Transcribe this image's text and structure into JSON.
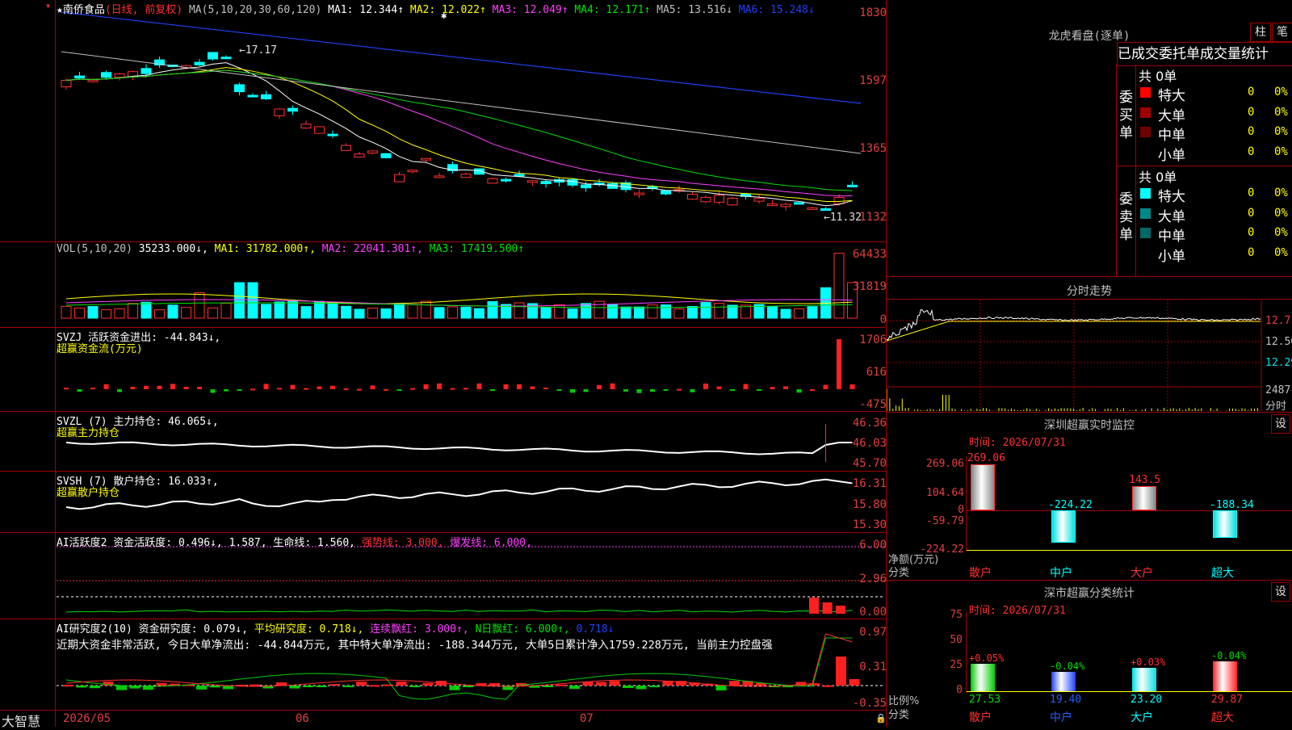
{
  "stock": {
    "name": "★南侨食品",
    "period": "(日线, 前复权)",
    "ma_line": [
      {
        "t": "MA(5,10,20,30,60,120)",
        "c": "#c0c0c0"
      },
      {
        "t": "MA1: 12.344↑",
        "c": "#ffffff"
      },
      {
        "t": "MA2: 12.022↑",
        "c": "#ffff00"
      },
      {
        "t": "MA3: 12.049↑",
        "c": "#ff40ff"
      },
      {
        "t": "MA4: 12.171↑",
        "c": "#00e000"
      },
      {
        "t": "MA5: 13.516↓",
        "c": "#c0c0c0"
      },
      {
        "t": "MA6: 15.248↓",
        "c": "#2040ff"
      }
    ],
    "price_axis": [
      "1830",
      "1597",
      "1365",
      "1132"
    ],
    "high_label": "17.17",
    "low_label": "11.32"
  },
  "volume": {
    "header": [
      {
        "t": "VOL(5,10,20)",
        "c": "#c0c0c0"
      },
      {
        "t": "35233.000↓,",
        "c": "#ffffff"
      },
      {
        "t": "MA1: 31782.000↑,",
        "c": "#ffff00"
      },
      {
        "t": "MA2: 22041.301↑,",
        "c": "#ff40ff"
      },
      {
        "t": "MA3: 17419.500↑",
        "c": "#00e000"
      }
    ],
    "axis": [
      "64433",
      "31819",
      "0"
    ]
  },
  "svzj": {
    "line1": "SVZJ  活跃资金进出: -44.843↓,",
    "line2": "超赢资金流(万元)",
    "axis": [
      "1706",
      "616",
      "-475"
    ]
  },
  "svzl": {
    "line1": "SVZL (7) 主力持仓: 46.065↓,",
    "line2": "超赢主力持仓",
    "axis": [
      "46.36",
      "46.03",
      "45.70"
    ]
  },
  "svsh": {
    "line1": "SVSH (7) 散户持仓: 16.033↑,",
    "line2": "超赢散户持仓",
    "axis": [
      "16.31",
      "15.80",
      "15.30"
    ]
  },
  "ai_active": {
    "header": [
      {
        "t": "AI活跃度2 资金活跃度: 0.496↓,",
        "c": "#ffffff"
      },
      {
        "t": "1.587,",
        "c": "#ffffff"
      },
      {
        "t": "生命线: 1.560,",
        "c": "#ffffff"
      },
      {
        "t": "强势线: 3.000,",
        "c": "#ff3030"
      },
      {
        "t": "爆发线: 6.000,",
        "c": "#ff40ff"
      }
    ],
    "axis": [
      "6.00",
      "2.96",
      "0.00"
    ]
  },
  "ai_research": {
    "header": [
      {
        "t": "AI研究度2(10) 资金研究度: 0.079↓,",
        "c": "#ffffff"
      },
      {
        "t": "平均研究度: 0.718↓,",
        "c": "#ffff00"
      },
      {
        "t": "连续飘红: 3.000↑,",
        "c": "#ff40ff"
      },
      {
        "t": "N日飘红: 6.000↑,",
        "c": "#00e000"
      },
      {
        "t": "0.718↓",
        "c": "#2040ff"
      }
    ],
    "comment": "近期大资金非常活跃, 今日大单净流出: -44.844万元, 其中特大单净流出: -188.344万元, 大单5日累计净入1759.228万元, 当前主力控盘强",
    "axis": [
      "0.97",
      "0.31",
      "-0.35"
    ]
  },
  "date_axis": {
    "brand": "大智慧",
    "labels": [
      "2026/05",
      "06",
      "07"
    ]
  },
  "dragon_tiger": {
    "title": "龙虎看盘(逐单)",
    "btn_bar": "柱",
    "btn_pen": "笔",
    "tabs": [
      "已成交",
      "委托单",
      "成交量统计"
    ],
    "buy_side_label": "委买单",
    "sell_side_label": "委卖单",
    "buy_total": "共 0单",
    "sell_total": "共 0单",
    "buy_rows": [
      {
        "label": "特大",
        "count": "0",
        "pct": "0%",
        "color": "#ff0000"
      },
      {
        "label": "大单",
        "count": "0",
        "pct": "0%",
        "color": "#a00000"
      },
      {
        "label": "中单",
        "count": "0",
        "pct": "0%",
        "color": "#700000"
      },
      {
        "label": "小单",
        "count": "0",
        "pct": "0%",
        "color": "#000000"
      }
    ],
    "sell_rows": [
      {
        "label": "特大",
        "count": "0",
        "pct": "0%",
        "color": "#00ffff"
      },
      {
        "label": "大单",
        "count": "0",
        "pct": "0%",
        "color": "#008888"
      },
      {
        "label": "中单",
        "count": "0",
        "pct": "0%",
        "color": "#006868"
      },
      {
        "label": "小单",
        "count": "0",
        "pct": "0%",
        "color": "#000000"
      }
    ]
  },
  "intraday": {
    "title": "分时走势",
    "axis": [
      "12.71",
      "12.50",
      "12.29"
    ],
    "vol_label": "2487",
    "unit": "分时"
  },
  "sz_monitor": {
    "title": "深圳超赢实时监控",
    "btn": "设",
    "time": "时间: 2026/07/31",
    "axis": [
      "269.06",
      "104.64",
      "0",
      "-59.79",
      "-224.22"
    ],
    "side_label_1": "净额(万元)",
    "side_label_2": "分类",
    "bars": [
      {
        "cat": "散户",
        "value": "269.06",
        "v": 269.06,
        "cat_color": "#ff3030",
        "val_color": "#ff3030"
      },
      {
        "cat": "中户",
        "value": "-224.22",
        "v": -224.22,
        "cat_color": "#00ffff",
        "val_color": "#00ffff"
      },
      {
        "cat": "大户",
        "value": "143.5",
        "v": 143.5,
        "cat_color": "#ff3030",
        "val_color": "#ff3030"
      },
      {
        "cat": "超大",
        "value": "-188.34",
        "v": -188.34,
        "cat_color": "#00ffff",
        "val_color": "#00ffff"
      }
    ]
  },
  "sz_class": {
    "title": "深市超赢分类统计",
    "btn": "设",
    "time": "时间: 2026/07/31",
    "axis": [
      "75",
      "50",
      "25",
      "0"
    ],
    "side_label_1": "比例%",
    "side_label_2": "分类",
    "bars": [
      {
        "cat": "散户",
        "pct_text": "27.53",
        "change": "+0.05%",
        "pct": 27.53,
        "change_color": "#ff3030",
        "cat_color": "#ff3030",
        "pct_color": "#00e000",
        "bar": "#00cc00"
      },
      {
        "cat": "中户",
        "pct_text": "19.40",
        "change": "-0.04%",
        "pct": 19.4,
        "change_color": "#00e000",
        "cat_color": "#2060ff",
        "pct_color": "#2060ff",
        "bar": "#2040ff"
      },
      {
        "cat": "大户",
        "pct_text": "23.20",
        "change": "+0.03%",
        "pct": 23.2,
        "change_color": "#ff3030",
        "cat_color": "#00ffff",
        "pct_color": "#00ffff",
        "bar": "#00e0e0"
      },
      {
        "cat": "超大",
        "pct_text": "29.87",
        "change": "-0.04%",
        "pct": 29.87,
        "change_color": "#00e000",
        "cat_color": "#ff3030",
        "pct_color": "#ff3030",
        "bar": "#ff2020"
      }
    ]
  }
}
